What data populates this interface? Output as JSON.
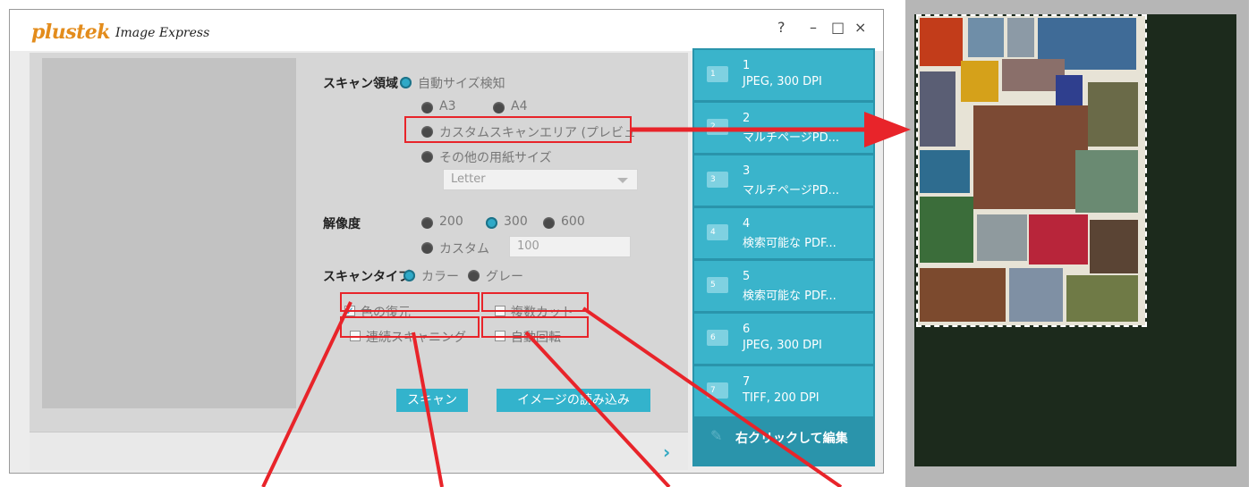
{
  "window": {
    "brand": "plustek",
    "product": "Image Express",
    "help": "?",
    "minimize": "–",
    "maximize": "□",
    "close": "×"
  },
  "scan_area": {
    "label": "スキャン領域",
    "auto_size": "自動サイズ検知",
    "a3": "A3",
    "a4": "A4",
    "custom_area": "カスタムスキャンエリア (プレビュー",
    "other_size": "その他の用紙サイズ",
    "paper_select_value": "Letter"
  },
  "resolution": {
    "label": "解像度",
    "dpi_200": "200",
    "dpi_300": "300",
    "dpi_600": "600",
    "custom": "カスタム",
    "custom_value": "100"
  },
  "scan_type": {
    "label": "スキャンタイプ",
    "color": "カラー",
    "gray": "グレー"
  },
  "options": {
    "color_restore": "色の復元",
    "multi_crop": "複数カット",
    "continuous_scan": "連続スキャニング",
    "auto_rotate": "自動回転"
  },
  "buttons": {
    "scan": "スキャン",
    "import_image": "イメージの読み込み"
  },
  "nav_arrow": "›",
  "presets": [
    {
      "num": "1",
      "title": "1",
      "subtitle": "JPEG, 300 DPI"
    },
    {
      "num": "2",
      "title": "2",
      "subtitle": "マルチページPD..."
    },
    {
      "num": "3",
      "title": "3",
      "subtitle": "マルチページPD..."
    },
    {
      "num": "4",
      "title": "4",
      "subtitle": "検索可能な PDF..."
    },
    {
      "num": "5",
      "title": "5",
      "subtitle": "検索可能な PDF..."
    },
    {
      "num": "6",
      "title": "6",
      "subtitle": "JPEG, 300 DPI"
    },
    {
      "num": "7",
      "title": "7",
      "subtitle": "TIFF, 200 DPI"
    }
  ],
  "edit_hint": "右クリックして編集",
  "selected": {
    "scan_area": "auto_size",
    "resolution": "300",
    "scan_type": "color",
    "color_restore_checked": true
  },
  "colors": {
    "accent": "#33b3cc",
    "preset_bg": "#3ab4cb",
    "preset_panel": "#2a94ab",
    "brand_orange": "#e38c1c",
    "annotation_red": "#e8242a"
  }
}
